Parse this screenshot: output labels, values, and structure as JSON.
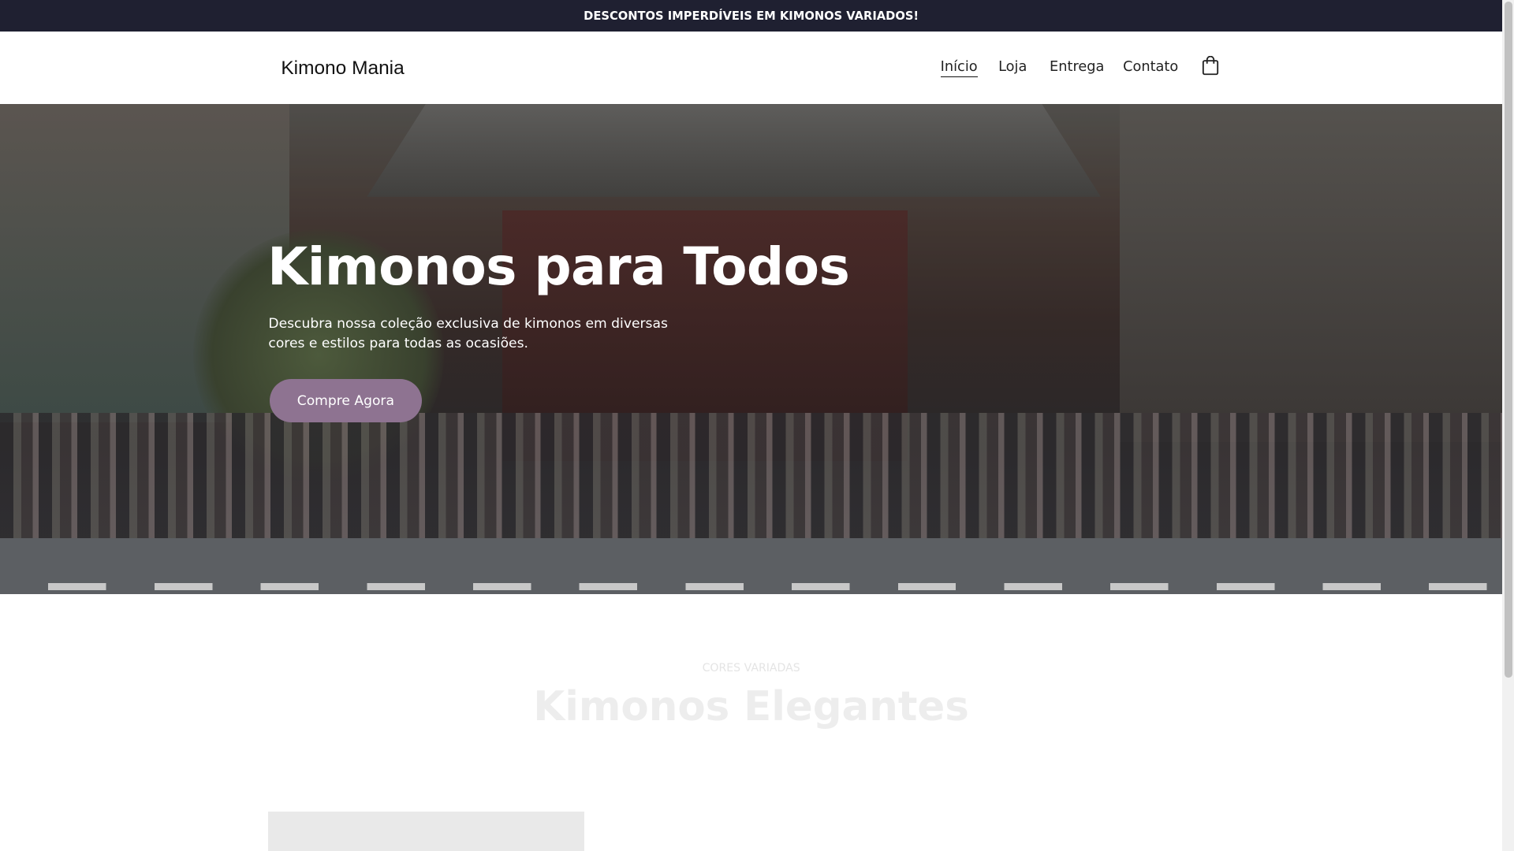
{
  "announcement": "DESCONTOS IMPERDÍVEIS EM KIMONOS VARIADOS!",
  "header": {
    "logo": "Kimono Mania",
    "nav": [
      "Início",
      "Loja",
      "Entrega",
      "Contato"
    ],
    "cart_icon": "shopping-bag-icon"
  },
  "hero": {
    "title": "Kimonos para Todos",
    "subtitle": "Descubra nossa coleção exclusiva de kimonos em diversas cores e estilos para todas as ocasiões.",
    "cta": "Compre Agora",
    "cta_color": "#8e7391"
  },
  "section": {
    "eyebrow": "CORES VARIADAS",
    "title": "Kimonos Elegantes"
  }
}
